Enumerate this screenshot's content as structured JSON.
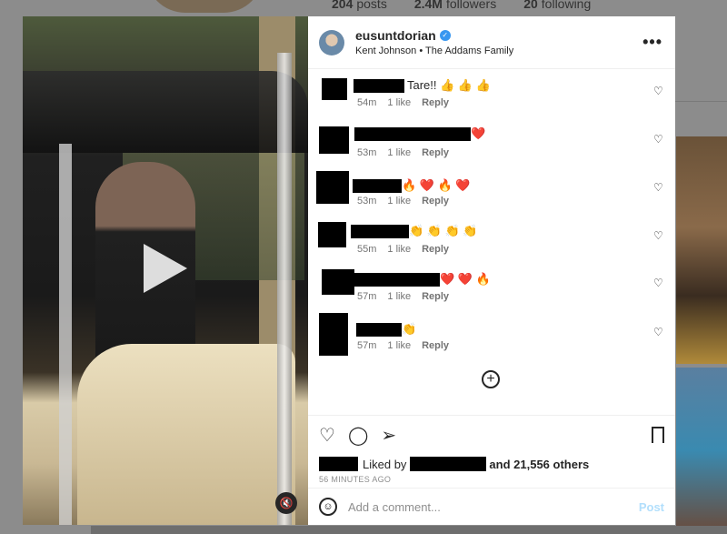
{
  "background": {
    "stats": [
      {
        "value": "204",
        "label": "posts"
      },
      {
        "value": "2.4M",
        "label": "followers"
      },
      {
        "value": "20",
        "label": "following"
      }
    ]
  },
  "post": {
    "username": "eusuntdorian",
    "subtitle": "Kent Johnson • The Addams Family",
    "more_icon": "more-horizontal-icon"
  },
  "comments": [
    {
      "text": "Tare!! 👍 👍 👍",
      "time": "54m",
      "likes": "1 like",
      "reply": "Reply"
    },
    {
      "text": "❤️",
      "time": "53m",
      "likes": "1 like",
      "reply": "Reply"
    },
    {
      "text": "🔥 ❤️ 🔥 ❤️",
      "time": "53m",
      "likes": "1 like",
      "reply": "Reply"
    },
    {
      "text": "👏 👏 👏 👏",
      "time": "55m",
      "likes": "1 like",
      "reply": "Reply"
    },
    {
      "text": "❤️ ❤️ 🔥",
      "time": "57m",
      "likes": "1 like",
      "reply": "Reply"
    },
    {
      "text": "👏",
      "time": "57m",
      "likes": "1 like",
      "reply": "Reply"
    }
  ],
  "likes": {
    "liked_by": "Liked by",
    "and_others": "and 21,556 others",
    "time_ago": "56 MINUTES AGO"
  },
  "add_comment": {
    "placeholder": "Add a comment...",
    "post_label": "Post"
  }
}
